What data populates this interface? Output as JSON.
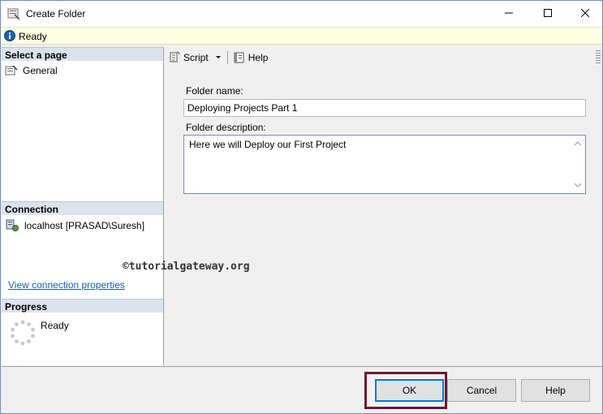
{
  "window": {
    "title": "Create Folder"
  },
  "status": {
    "text": "Ready"
  },
  "left": {
    "select_page_header": "Select a page",
    "pages": [
      {
        "label": "General",
        "icon": "page-settings-icon"
      }
    ],
    "connection_header": "Connection",
    "connection_label": "localhost [PRASAD\\Suresh]",
    "view_connection_link": "View connection properties",
    "progress_header": "Progress",
    "progress_status": "Ready"
  },
  "toolbar": {
    "script_label": "Script",
    "help_label": "Help"
  },
  "form": {
    "folder_name_label": "Folder name:",
    "folder_name_value": "Deploying Projects Part 1",
    "folder_description_label": "Folder description:",
    "folder_description_value": "Here we will Deploy our First Project"
  },
  "watermark": "©tutorialgateway.org",
  "buttons": {
    "ok": "OK",
    "cancel": "Cancel",
    "help": "Help"
  },
  "colors": {
    "status_bar_bg": "#ffffe1",
    "section_header_bg": "#dde3ec",
    "link": "#1560bd",
    "ok_outline": "#6b1a2a",
    "focus_border": "#0078d7"
  }
}
